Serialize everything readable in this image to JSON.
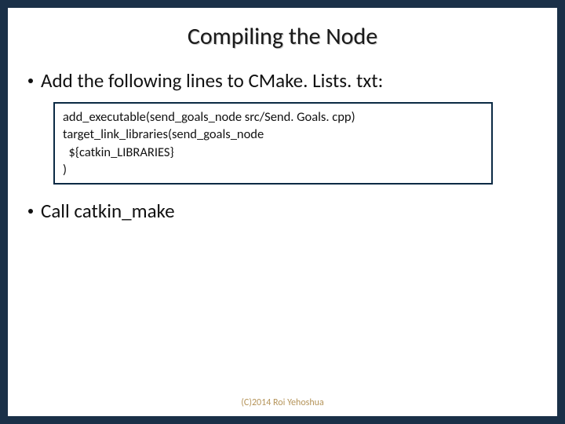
{
  "title": "Compiling the Node",
  "bullets": {
    "b1": "Add the following lines to CMake. Lists. txt:",
    "b2": "Call catkin_make"
  },
  "code": {
    "l1": "add_executable(send_goals_node src/Send. Goals. cpp)",
    "l2": "target_link_libraries(send_goals_node",
    "l3": "  ${catkin_LIBRARIES}",
    "l4": ")"
  },
  "footer": "(C)2014 Roi Yehoshua"
}
